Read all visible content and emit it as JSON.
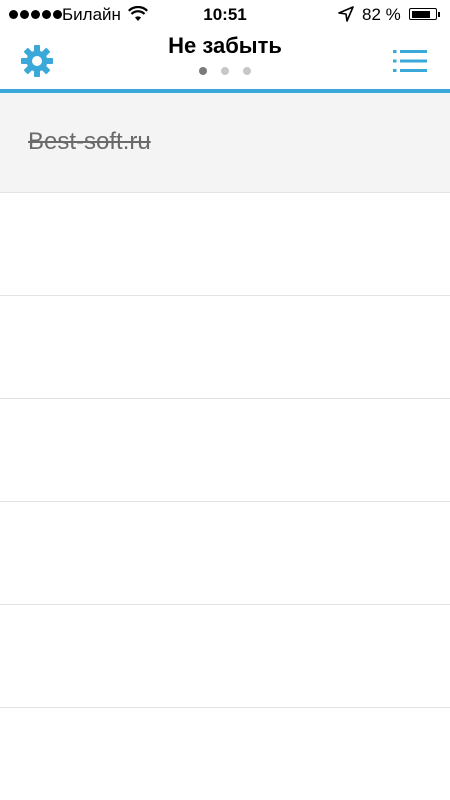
{
  "status_bar": {
    "signal_icon": "signal-dots-icon",
    "carrier": "Билайн",
    "wifi_icon": "wifi-icon",
    "time": "10:51",
    "location_icon": "location-arrow-icon",
    "battery_percent": "82 %",
    "battery_level": 0.82,
    "battery_icon": "battery-icon"
  },
  "nav": {
    "title": "Не забыть",
    "settings_icon": "gear-icon",
    "menu_icon": "list-icon",
    "page_count": 3,
    "active_page": 1
  },
  "colors": {
    "accent": "#3aa8d8",
    "completed_text": "#6a6a6a",
    "row_separator": "#e3e3e3"
  },
  "list": {
    "items": [
      {
        "text": "Best-soft.ru",
        "completed": true
      }
    ],
    "empty_rows": 6
  }
}
